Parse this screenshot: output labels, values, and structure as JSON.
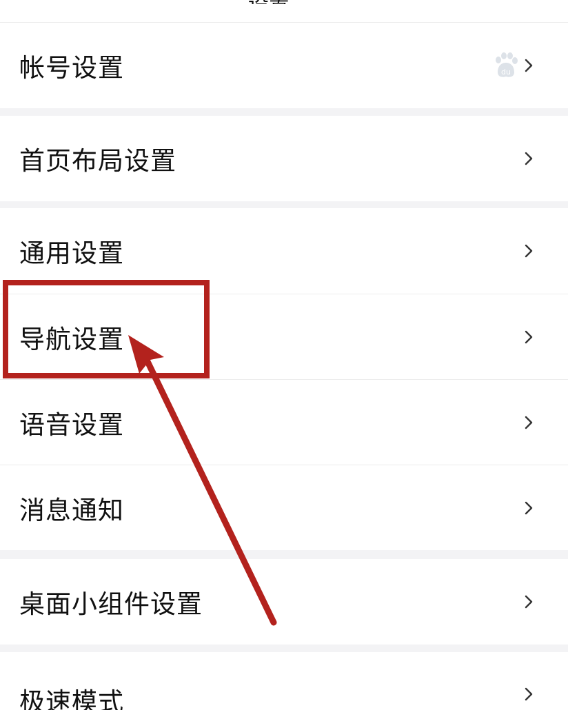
{
  "header": {
    "title": "设置"
  },
  "groups": [
    {
      "items": [
        {
          "label": "帐号设置",
          "icon": "baidu-paw-icon"
        }
      ]
    },
    {
      "items": [
        {
          "label": "首页布局设置"
        }
      ]
    },
    {
      "items": [
        {
          "label": "通用设置"
        },
        {
          "label": "导航设置"
        },
        {
          "label": "语音设置"
        },
        {
          "label": "消息通知"
        }
      ]
    },
    {
      "items": [
        {
          "label": "桌面小组件设置"
        }
      ]
    },
    {
      "items": [
        {
          "label": "极速模式"
        }
      ]
    }
  ],
  "annotation": {
    "highlight_color": "#b3221d",
    "arrow_color": "#b3221d",
    "highlighted_item": "导航设置"
  }
}
